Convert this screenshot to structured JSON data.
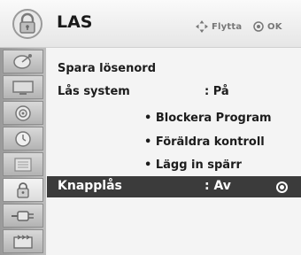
{
  "header": {
    "title": "LAS",
    "hint_move_icon": "four-way-arrows-icon",
    "hint_move_label": "Flytta",
    "hint_ok_icon": "ok-circle-icon",
    "hint_ok_label": "OK"
  },
  "sidebar": {
    "items": [
      {
        "icon": "satellite-dish-icon"
      },
      {
        "icon": "picture-tv-icon"
      },
      {
        "icon": "audio-speaker-icon"
      },
      {
        "icon": "clock-icon"
      },
      {
        "icon": "option-icon"
      },
      {
        "icon": "lock-icon",
        "active": true
      },
      {
        "icon": "input-plug-icon"
      },
      {
        "icon": "usb-icon"
      }
    ]
  },
  "menu": {
    "password": {
      "label": "Spara lösenord"
    },
    "lock_system": {
      "label": "Lås system",
      "value": ": På"
    },
    "block_program": {
      "label": "• Blockera Program"
    },
    "parental": {
      "label": "• Föräldra kontroll"
    },
    "input_block": {
      "label": "• Lägg in spärr"
    },
    "key_lock": {
      "label": "Knapplås",
      "value": ": Av",
      "selected": true
    }
  },
  "colors": {
    "selected_row": "#3b3b3b",
    "sidebar_bg": "#a8a8a8",
    "content_bg": "#f4f4f4"
  }
}
